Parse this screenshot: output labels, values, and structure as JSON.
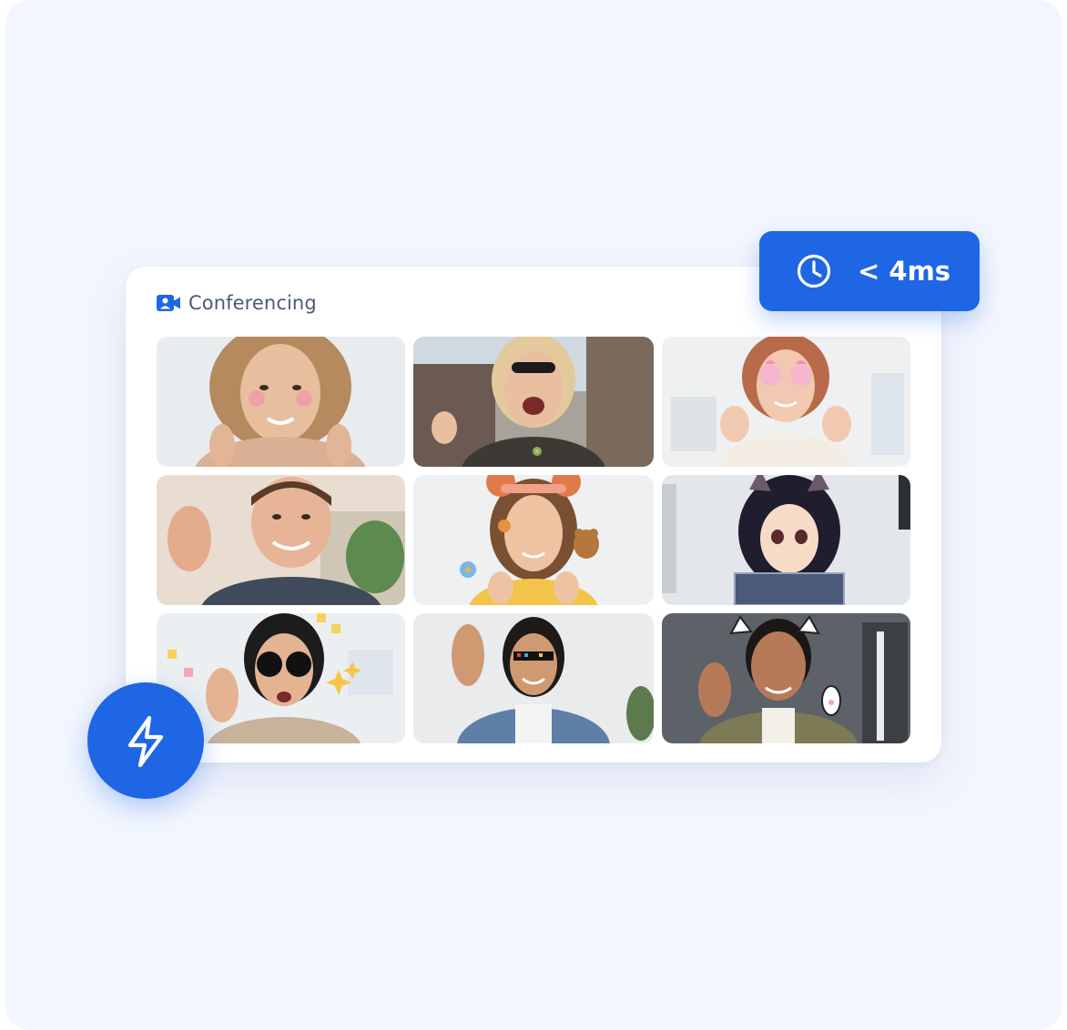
{
  "header": {
    "title": "Conferencing",
    "icon": "video-camera-icon"
  },
  "latency_badge": {
    "icon": "clock-icon",
    "label": "< 4ms"
  },
  "speed_badge": {
    "icon": "lightning-bolt-icon"
  },
  "colors": {
    "accent": "#1f66e5",
    "background": "#f2f6fe",
    "card": "#ffffff",
    "title_text": "#4b5b72"
  },
  "participants": [
    {
      "effect": "blush-cheeks"
    },
    {
      "effect": "sunglasses"
    },
    {
      "effect": "heart-glasses"
    },
    {
      "effect": "none"
    },
    {
      "effect": "bear-ears-headband"
    },
    {
      "effect": "anime-avatar-cat-ears"
    },
    {
      "effect": "round-sunglasses-sparkles"
    },
    {
      "effect": "pixel-sunglasses"
    },
    {
      "effect": "cat-ears-paw"
    }
  ]
}
